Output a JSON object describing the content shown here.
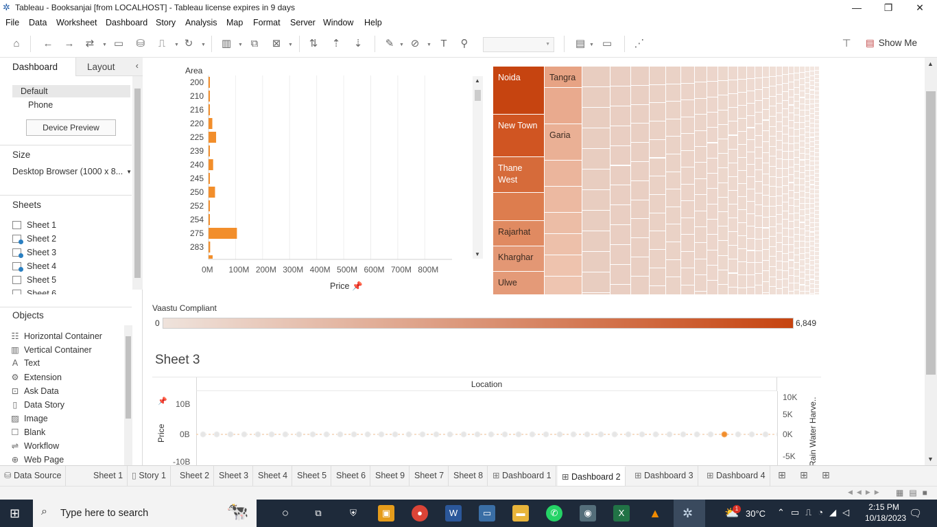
{
  "window": {
    "title": "Tableau - Booksanjai [from LOCALHOST] - Tableau license expires in 9 days"
  },
  "menu": [
    "File",
    "Data",
    "Worksheet",
    "Dashboard",
    "Story",
    "Analysis",
    "Map",
    "Format",
    "Server",
    "Window",
    "Help"
  ],
  "toolbar": {
    "show_me": "Show Me"
  },
  "leftpane": {
    "tabs": {
      "dashboard": "Dashboard",
      "layout": "Layout"
    },
    "device": {
      "default": "Default",
      "phone": "Phone",
      "preview_button": "Device Preview"
    },
    "size": {
      "heading": "Size",
      "value": "Desktop Browser (1000 x 8..."
    },
    "sheets": {
      "heading": "Sheets",
      "items": [
        "Sheet 1",
        "Sheet 2",
        "Sheet 3",
        "Sheet 4",
        "Sheet 5",
        "Sheet 6"
      ]
    },
    "objects": {
      "heading": "Objects",
      "items": [
        "Horizontal Container",
        "Vertical Container",
        "Text",
        "Extension",
        "Ask Data",
        "Data Story",
        "Image",
        "Blank",
        "Workflow",
        "Web Page"
      ]
    }
  },
  "bar_chart": {
    "row_header": "Area",
    "xlabel": "Price",
    "x_ticks": [
      "0M",
      "100M",
      "200M",
      "300M",
      "400M",
      "500M",
      "600M",
      "700M",
      "800M"
    ]
  },
  "treemap": {
    "labels": [
      "Noida",
      "New Town",
      "Thane West",
      "Rajarhat",
      "Kharghar",
      "Ulwe",
      "Tangra",
      "Garia"
    ]
  },
  "legend": {
    "title": "Vaastu Compliant",
    "min": "0",
    "max": "6,849",
    "color_low": "#efe3dc",
    "color_high": "#c64410"
  },
  "sheet3": {
    "title": "Sheet 3",
    "column_header": "Location",
    "left_axis_label": "Price",
    "right_axis_label": "Rain Water Harve..",
    "left_ticks": [
      "10B",
      "0B",
      "-10B"
    ],
    "right_ticks": [
      "10K",
      "5K",
      "0K",
      "-5K"
    ]
  },
  "chart_data": [
    {
      "type": "bar",
      "title": "",
      "xlabel": "Price",
      "ylabel": "Area",
      "categories": [
        "200",
        "210",
        "216",
        "220",
        "225",
        "239",
        "240",
        "245",
        "250",
        "252",
        "254",
        "275",
        "283"
      ],
      "values": [
        4,
        2,
        2,
        14,
        28,
        5,
        17,
        5,
        24,
        1,
        1,
        105,
        6
      ],
      "unit": "M",
      "xlim": [
        0,
        850
      ],
      "color": "#f28e2b"
    }
  ],
  "tabs": [
    "Data Source",
    "Sheet 1",
    "Story 1",
    "Sheet 2",
    "Sheet 3",
    "Sheet 4",
    "Sheet 5",
    "Sheet 6",
    "Sheet 9",
    "Sheet 7",
    "Sheet 8",
    "Dashboard 1",
    "Dashboard 2",
    "Dashboard 3",
    "Dashboard 4"
  ],
  "active_tab": "Dashboard 2",
  "taskbar": {
    "search_placeholder": "Type here to search",
    "weather": "30°C",
    "time": "2:15 PM",
    "date": "10/18/2023",
    "notification_count": "1"
  }
}
